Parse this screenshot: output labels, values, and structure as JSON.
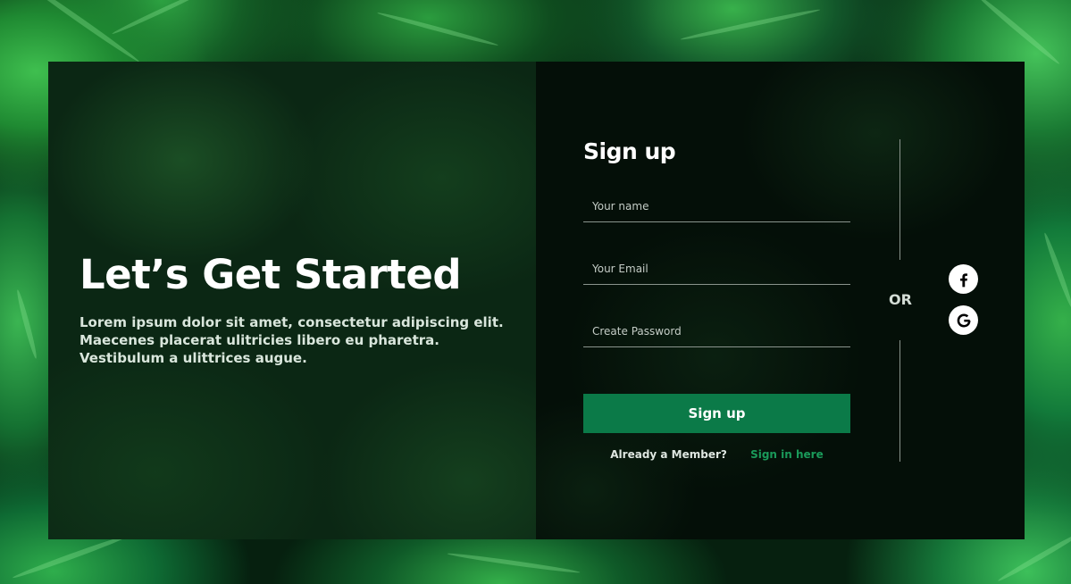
{
  "hero": {
    "title": "Let’s Get Started",
    "text": "Lorem ipsum dolor sit amet, consectetur adipiscing elit. Maecenes placerat ulitricies libero eu pharetra. Vestibulum a ulittrices augue."
  },
  "form": {
    "title": "Sign up",
    "fields": {
      "name": {
        "placeholder": "Your name",
        "value": ""
      },
      "email": {
        "placeholder": "Your Email",
        "value": ""
      },
      "password": {
        "placeholder": "Create Password",
        "value": ""
      }
    },
    "submit_label": "Sign up",
    "member_text": "Already a Member?",
    "signin_link": "Sign in here"
  },
  "social": {
    "or_label": "OR",
    "buttons": [
      {
        "name": "facebook",
        "icon": "facebook-icon"
      },
      {
        "name": "google",
        "icon": "google-icon"
      }
    ]
  },
  "colors": {
    "accent": "#0b7a48",
    "link": "#1a9a5a",
    "panel_left": "#0b2714",
    "panel_right": "#040f08"
  }
}
